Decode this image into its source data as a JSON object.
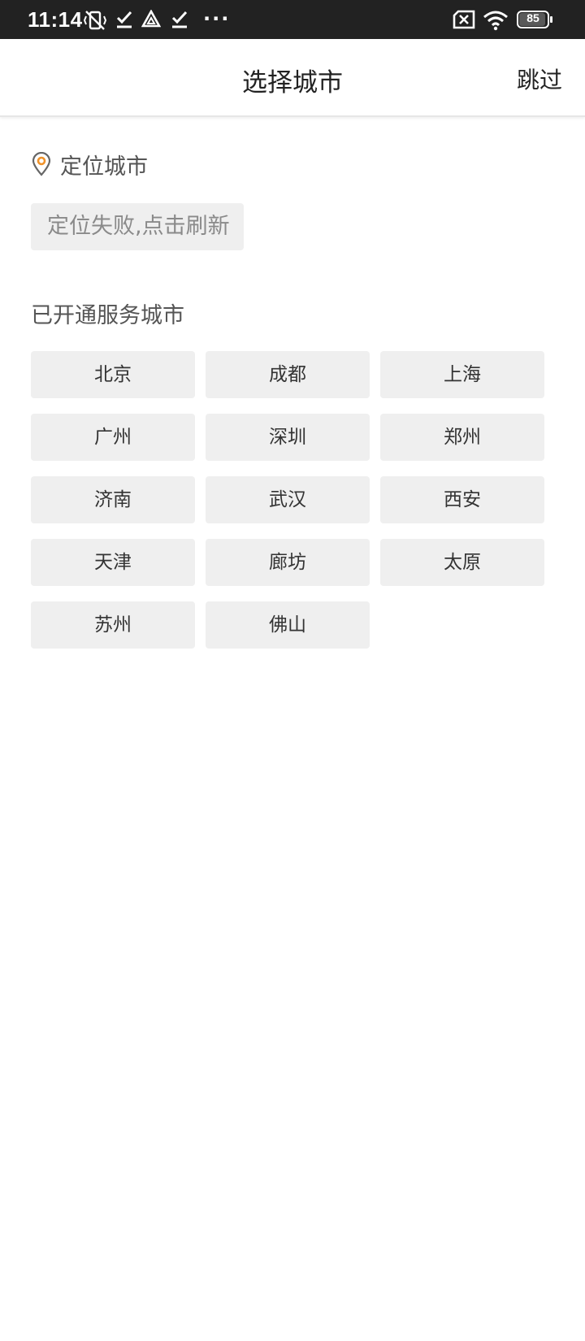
{
  "status_bar": {
    "time": "11:14",
    "battery": "85",
    "icons": [
      "vibrate-off-icon",
      "check-icon",
      "drive-icon",
      "check-icon",
      "more-dots-icon",
      "no-sim-icon",
      "wifi-icon",
      "battery-icon"
    ],
    "dots": "···"
  },
  "header": {
    "title": "选择城市",
    "skip_label": "跳过"
  },
  "location": {
    "label": "定位城市",
    "icon": "location-pin-icon",
    "icon_color": "#f0932b",
    "refresh_text": "定位失败,点击刷新"
  },
  "service": {
    "title": "已开通服务城市",
    "cities": [
      "北京",
      "成都",
      "上海",
      "广州",
      "深圳",
      "郑州",
      "济南",
      "武汉",
      "西安",
      "天津",
      "廊坊",
      "太原",
      "苏州",
      "佛山"
    ]
  }
}
